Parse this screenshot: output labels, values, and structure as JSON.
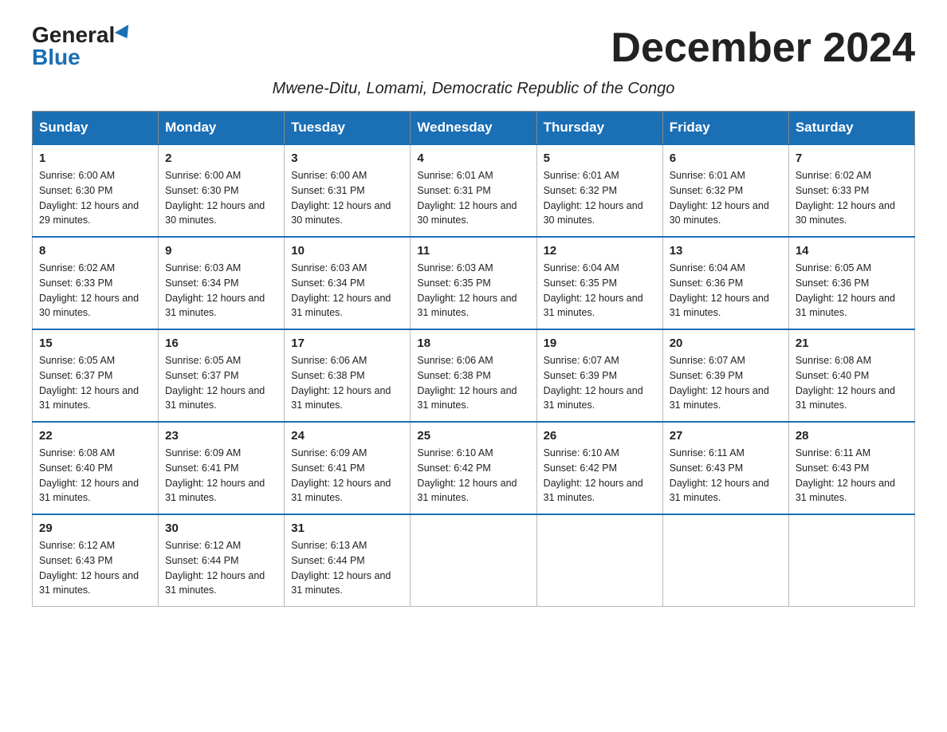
{
  "logo": {
    "general": "General",
    "blue": "Blue"
  },
  "title": "December 2024",
  "subtitle": "Mwene-Ditu, Lomami, Democratic Republic of the Congo",
  "days_of_week": [
    "Sunday",
    "Monday",
    "Tuesday",
    "Wednesday",
    "Thursday",
    "Friday",
    "Saturday"
  ],
  "weeks": [
    [
      {
        "day": "1",
        "sunrise": "6:00 AM",
        "sunset": "6:30 PM",
        "daylight": "12 hours and 29 minutes."
      },
      {
        "day": "2",
        "sunrise": "6:00 AM",
        "sunset": "6:30 PM",
        "daylight": "12 hours and 30 minutes."
      },
      {
        "day": "3",
        "sunrise": "6:00 AM",
        "sunset": "6:31 PM",
        "daylight": "12 hours and 30 minutes."
      },
      {
        "day": "4",
        "sunrise": "6:01 AM",
        "sunset": "6:31 PM",
        "daylight": "12 hours and 30 minutes."
      },
      {
        "day": "5",
        "sunrise": "6:01 AM",
        "sunset": "6:32 PM",
        "daylight": "12 hours and 30 minutes."
      },
      {
        "day": "6",
        "sunrise": "6:01 AM",
        "sunset": "6:32 PM",
        "daylight": "12 hours and 30 minutes."
      },
      {
        "day": "7",
        "sunrise": "6:02 AM",
        "sunset": "6:33 PM",
        "daylight": "12 hours and 30 minutes."
      }
    ],
    [
      {
        "day": "8",
        "sunrise": "6:02 AM",
        "sunset": "6:33 PM",
        "daylight": "12 hours and 30 minutes."
      },
      {
        "day": "9",
        "sunrise": "6:03 AM",
        "sunset": "6:34 PM",
        "daylight": "12 hours and 31 minutes."
      },
      {
        "day": "10",
        "sunrise": "6:03 AM",
        "sunset": "6:34 PM",
        "daylight": "12 hours and 31 minutes."
      },
      {
        "day": "11",
        "sunrise": "6:03 AM",
        "sunset": "6:35 PM",
        "daylight": "12 hours and 31 minutes."
      },
      {
        "day": "12",
        "sunrise": "6:04 AM",
        "sunset": "6:35 PM",
        "daylight": "12 hours and 31 minutes."
      },
      {
        "day": "13",
        "sunrise": "6:04 AM",
        "sunset": "6:36 PM",
        "daylight": "12 hours and 31 minutes."
      },
      {
        "day": "14",
        "sunrise": "6:05 AM",
        "sunset": "6:36 PM",
        "daylight": "12 hours and 31 minutes."
      }
    ],
    [
      {
        "day": "15",
        "sunrise": "6:05 AM",
        "sunset": "6:37 PM",
        "daylight": "12 hours and 31 minutes."
      },
      {
        "day": "16",
        "sunrise": "6:05 AM",
        "sunset": "6:37 PM",
        "daylight": "12 hours and 31 minutes."
      },
      {
        "day": "17",
        "sunrise": "6:06 AM",
        "sunset": "6:38 PM",
        "daylight": "12 hours and 31 minutes."
      },
      {
        "day": "18",
        "sunrise": "6:06 AM",
        "sunset": "6:38 PM",
        "daylight": "12 hours and 31 minutes."
      },
      {
        "day": "19",
        "sunrise": "6:07 AM",
        "sunset": "6:39 PM",
        "daylight": "12 hours and 31 minutes."
      },
      {
        "day": "20",
        "sunrise": "6:07 AM",
        "sunset": "6:39 PM",
        "daylight": "12 hours and 31 minutes."
      },
      {
        "day": "21",
        "sunrise": "6:08 AM",
        "sunset": "6:40 PM",
        "daylight": "12 hours and 31 minutes."
      }
    ],
    [
      {
        "day": "22",
        "sunrise": "6:08 AM",
        "sunset": "6:40 PM",
        "daylight": "12 hours and 31 minutes."
      },
      {
        "day": "23",
        "sunrise": "6:09 AM",
        "sunset": "6:41 PM",
        "daylight": "12 hours and 31 minutes."
      },
      {
        "day": "24",
        "sunrise": "6:09 AM",
        "sunset": "6:41 PM",
        "daylight": "12 hours and 31 minutes."
      },
      {
        "day": "25",
        "sunrise": "6:10 AM",
        "sunset": "6:42 PM",
        "daylight": "12 hours and 31 minutes."
      },
      {
        "day": "26",
        "sunrise": "6:10 AM",
        "sunset": "6:42 PM",
        "daylight": "12 hours and 31 minutes."
      },
      {
        "day": "27",
        "sunrise": "6:11 AM",
        "sunset": "6:43 PM",
        "daylight": "12 hours and 31 minutes."
      },
      {
        "day": "28",
        "sunrise": "6:11 AM",
        "sunset": "6:43 PM",
        "daylight": "12 hours and 31 minutes."
      }
    ],
    [
      {
        "day": "29",
        "sunrise": "6:12 AM",
        "sunset": "6:43 PM",
        "daylight": "12 hours and 31 minutes."
      },
      {
        "day": "30",
        "sunrise": "6:12 AM",
        "sunset": "6:44 PM",
        "daylight": "12 hours and 31 minutes."
      },
      {
        "day": "31",
        "sunrise": "6:13 AM",
        "sunset": "6:44 PM",
        "daylight": "12 hours and 31 minutes."
      },
      null,
      null,
      null,
      null
    ]
  ]
}
